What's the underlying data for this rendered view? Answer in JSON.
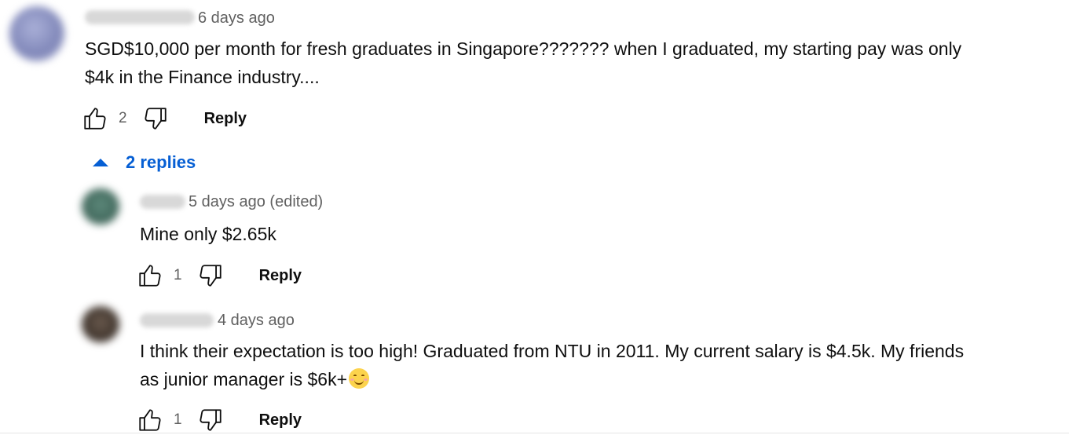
{
  "comment": {
    "timestamp": "6 days ago",
    "text_line1": "SGD$10,000 per month for fresh graduates in Singapore??????? when I graduated, my starting pay was only",
    "text_line2": "$4k in the Finance industry....",
    "likes": "2",
    "reply_label": "Reply",
    "replies_toggle_label": "2 replies",
    "avatar_color": "#8e95c4"
  },
  "replies": [
    {
      "timestamp": "5 days ago (edited)",
      "text_line1": "Mine only $2.65k",
      "likes": "1",
      "reply_label": "Reply",
      "avatar_color": "#4f7a6c"
    },
    {
      "timestamp": "4 days ago",
      "text_line1": "I think their expectation is too high! Graduated from NTU in 2011. My current salary is $4.5k. My friends",
      "text_line2": "as junior manager is $6k+",
      "emoji": "smiling-face-emoji",
      "likes": "1",
      "reply_label": "Reply",
      "avatar_color": "#4a3f36"
    }
  ],
  "colors": {
    "link_blue": "#065fd4",
    "text_primary": "#0f0f0f",
    "text_secondary": "#606060"
  }
}
